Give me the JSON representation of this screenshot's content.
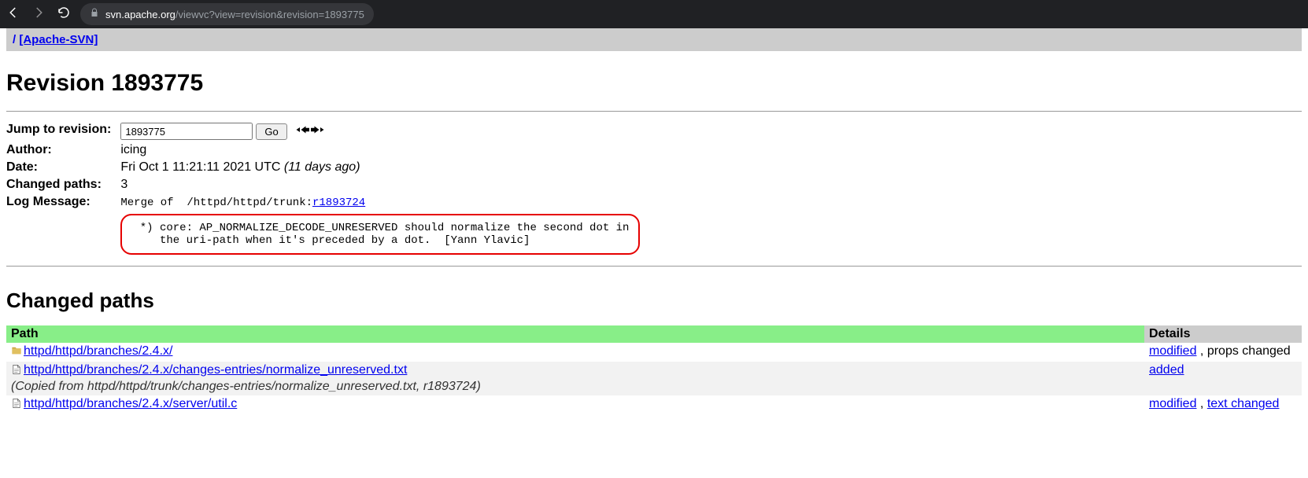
{
  "browser": {
    "url_host": "svn.apache.org",
    "url_rest": "/viewvc?view=revision&revision=1893775"
  },
  "breadcrumb": {
    "slash": "/",
    "root_label": "[Apache-SVN]"
  },
  "page_title": "Revision 1893775",
  "meta": {
    "jump_label": "Jump to revision:",
    "jump_value": "1893775",
    "go_label": "Go",
    "author_label": "Author:",
    "author_value": "icing",
    "date_label": "Date:",
    "date_value": "Fri Oct 1 11:21:11 2021 UTC",
    "date_ago": "(11 days ago)",
    "changed_paths_label": "Changed paths:",
    "changed_paths_value": "3",
    "log_label": "Log Message:",
    "log_merge_prefix": "Merge of  /httpd/httpd/trunk:",
    "log_merge_link": "r1893724",
    "log_body": " *) core: AP_NORMALIZE_DECODE_UNRESERVED should normalize the second dot in\n    the uri-path when it's preceded by a dot.  [Yann Ylavic]"
  },
  "changed_paths_title": "Changed paths",
  "table": {
    "header_path": "Path",
    "header_details": "Details",
    "rows": [
      {
        "icon": "folder",
        "path": "httpd/httpd/branches/2.4.x/",
        "copied": "",
        "detail_link": "modified",
        "detail_rest": " , props changed",
        "alt": false
      },
      {
        "icon": "file",
        "path": "httpd/httpd/branches/2.4.x/changes-entries/normalize_unreserved.txt",
        "copied": "(Copied from httpd/httpd/trunk/changes-entries/normalize_unreserved.txt, r1893724)",
        "detail_link": "added",
        "detail_rest": "",
        "alt": true
      },
      {
        "icon": "file",
        "path": "httpd/httpd/branches/2.4.x/server/util.c",
        "copied": "",
        "detail_link": "modified",
        "detail_rest": " , ",
        "detail_link2": "text changed",
        "alt": false
      }
    ]
  }
}
